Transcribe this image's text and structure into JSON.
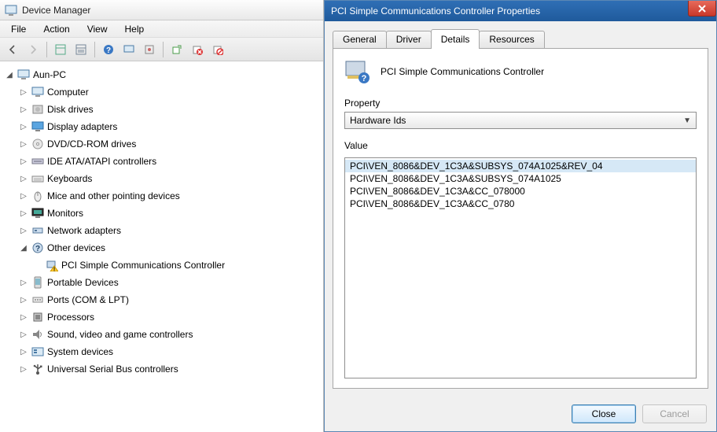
{
  "dm": {
    "title": "Device Manager",
    "menus": [
      "File",
      "Action",
      "View",
      "Help"
    ],
    "root": "Aun-PC",
    "categories": [
      {
        "label": "Computer",
        "icon": "computer"
      },
      {
        "label": "Disk drives",
        "icon": "disk"
      },
      {
        "label": "Display adapters",
        "icon": "display"
      },
      {
        "label": "DVD/CD-ROM drives",
        "icon": "cd"
      },
      {
        "label": "IDE ATA/ATAPI controllers",
        "icon": "ide"
      },
      {
        "label": "Keyboards",
        "icon": "keyboard"
      },
      {
        "label": "Mice and other pointing devices",
        "icon": "mouse"
      },
      {
        "label": "Monitors",
        "icon": "monitor"
      },
      {
        "label": "Network adapters",
        "icon": "network"
      },
      {
        "label": "Other devices",
        "icon": "other",
        "expanded": true,
        "children": [
          {
            "label": "PCI Simple Communications Controller",
            "icon": "warn"
          }
        ]
      },
      {
        "label": "Portable Devices",
        "icon": "portable"
      },
      {
        "label": "Ports (COM & LPT)",
        "icon": "port"
      },
      {
        "label": "Processors",
        "icon": "cpu"
      },
      {
        "label": "Sound, video and game controllers",
        "icon": "sound"
      },
      {
        "label": "System devices",
        "icon": "system"
      },
      {
        "label": "Universal Serial Bus controllers",
        "icon": "usb"
      }
    ]
  },
  "dlg": {
    "title": "PCI Simple Communications Controller Properties",
    "tabs": [
      "General",
      "Driver",
      "Details",
      "Resources"
    ],
    "active_tab": 2,
    "device_name": "PCI Simple Communications Controller",
    "property_label": "Property",
    "property_value": "Hardware Ids",
    "value_label": "Value",
    "values": [
      "PCI\\VEN_8086&DEV_1C3A&SUBSYS_074A1025&REV_04",
      "PCI\\VEN_8086&DEV_1C3A&SUBSYS_074A1025",
      "PCI\\VEN_8086&DEV_1C3A&CC_078000",
      "PCI\\VEN_8086&DEV_1C3A&CC_0780"
    ],
    "selected_value_index": 0,
    "close_label": "Close",
    "cancel_label": "Cancel"
  }
}
